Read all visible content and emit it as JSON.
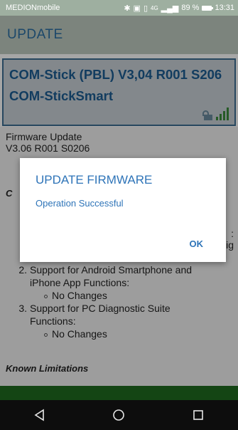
{
  "status_bar": {
    "carrier": "MEDIONmobile",
    "network": "4G",
    "battery": "89 %",
    "time": "13:31"
  },
  "app_bar": {
    "title": "UPDATE"
  },
  "device": {
    "name": "COM-Stick (PBL) V3,04 R001 S206",
    "subtitle": "COM-StickSmart",
    "lock_icon": "unlocked-padlock-icon",
    "signal_icon": "signal-strength-icon"
  },
  "content": {
    "firmware_label": "Firmware Update",
    "firmware_version": "V3.06 R001 S0206",
    "changes_heading_partial": "C",
    "right_fragment_1": ":",
    "right_fragment_2": "ig",
    "list": [
      {
        "number": "2.",
        "line1": "Support for Android Smartphone and",
        "line2": "iPhone App Functions:",
        "sub": "No Changes"
      },
      {
        "number": "3.",
        "line1": "Support for PC Diagnostic Suite",
        "line2": "Functions:",
        "sub": "No Changes"
      }
    ],
    "known_limitations": "Known Limitations"
  },
  "dialog": {
    "title": "UPDATE FIRMWARE",
    "message": "Operation Successful",
    "ok_label": "OK"
  },
  "nav_bar": {
    "back_icon": "back-triangle-icon",
    "home_icon": "home-circle-icon",
    "recents_icon": "recents-square-icon"
  },
  "colors": {
    "accent": "#2e74b8",
    "card_border": "#3d6d92",
    "green_bar": "#1f6b1f"
  }
}
